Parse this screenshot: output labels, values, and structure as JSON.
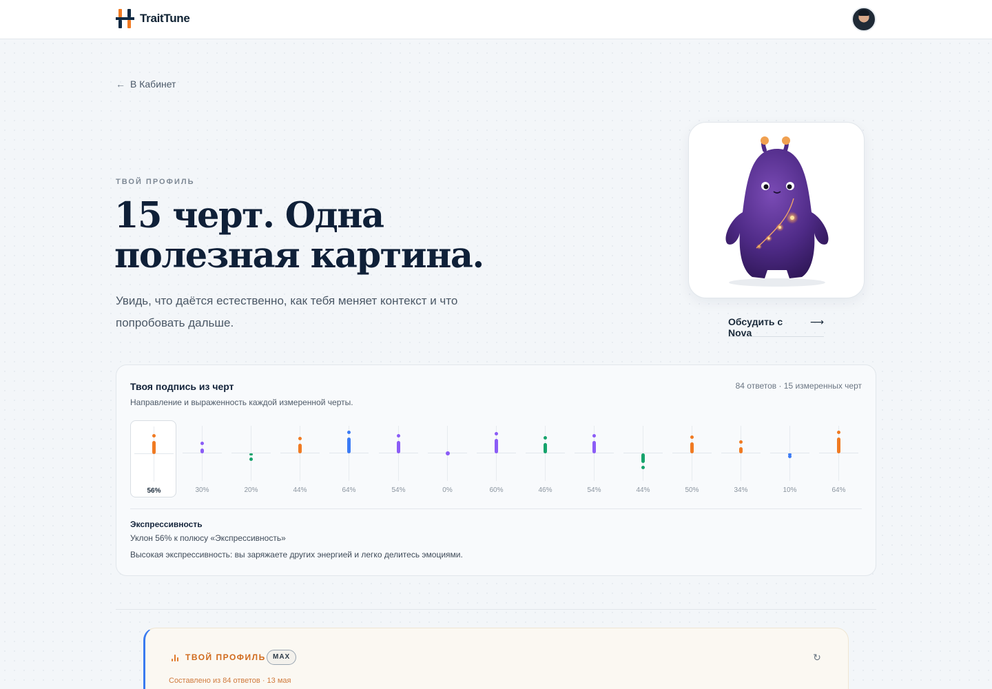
{
  "app": {
    "name": "TraitTune"
  },
  "nav": {
    "back_label": "В Кабинет"
  },
  "hero": {
    "eyebrow": "ТВОЙ ПРОФИЛЬ",
    "headline_line1": "15 черт. Одна",
    "headline_line2": "полезная картина.",
    "subtitle": "Увидь, что даётся естественно, как тебя меняет контекст и что попробовать дальше."
  },
  "mascot": {
    "discuss_label": "Обсудить с Nova",
    "arrow": "⟶"
  },
  "signature": {
    "title": "Твоя подпись из черт",
    "subtitle": "Направление и выраженность каждой измеренной черты.",
    "meta": "84 ответов · 15 измеренных черт",
    "selected_index": 0,
    "traits": [
      {
        "pct_label": "56%",
        "value": 56,
        "direction": "up",
        "color": "#f07a22"
      },
      {
        "pct_label": "30%",
        "value": 30,
        "direction": "up",
        "color": "#8b5cf6"
      },
      {
        "pct_label": "20%",
        "value": 20,
        "direction": "down",
        "color": "#16a36c"
      },
      {
        "pct_label": "44%",
        "value": 44,
        "direction": "up",
        "color": "#f07a22"
      },
      {
        "pct_label": "64%",
        "value": 64,
        "direction": "up",
        "color": "#3b7bf5"
      },
      {
        "pct_label": "54%",
        "value": 54,
        "direction": "up",
        "color": "#8b5cf6"
      },
      {
        "pct_label": "0%",
        "value": 0,
        "direction": "none",
        "color": "#8b5cf6"
      },
      {
        "pct_label": "60%",
        "value": 60,
        "direction": "up",
        "color": "#8b5cf6"
      },
      {
        "pct_label": "46%",
        "value": 46,
        "direction": "up",
        "color": "#16a36c"
      },
      {
        "pct_label": "54%",
        "value": 54,
        "direction": "up",
        "color": "#8b5cf6"
      },
      {
        "pct_label": "44%",
        "value": 44,
        "direction": "down",
        "color": "#16a36c"
      },
      {
        "pct_label": "50%",
        "value": 50,
        "direction": "up",
        "color": "#f07a22"
      },
      {
        "pct_label": "34%",
        "value": 34,
        "direction": "up",
        "color": "#f07a22"
      },
      {
        "pct_label": "10%",
        "value": 10,
        "direction": "down",
        "color": "#3b7bf5"
      },
      {
        "pct_label": "64%",
        "value": 64,
        "direction": "up",
        "color": "#f07a22"
      }
    ],
    "detail": {
      "name": "Экспрессивность",
      "bias": "Уклон 56% к полюсу «Экспрессивность»",
      "description": "Высокая экспрессивность: вы заряжаете других энергией и легко делитесь эмоциями."
    }
  },
  "profile_card": {
    "label": "ТВОЙ ПРОФИЛЬ",
    "badge": "MAX",
    "meta": "Составлено из 84 ответов · 13 мая",
    "refresh_icon": "refresh-icon"
  },
  "colors": {
    "accent_orange": "#f07a22",
    "accent_purple": "#8b5cf6",
    "accent_green": "#16a36c",
    "accent_blue": "#3b7bf5",
    "ink": "#0f2038"
  }
}
